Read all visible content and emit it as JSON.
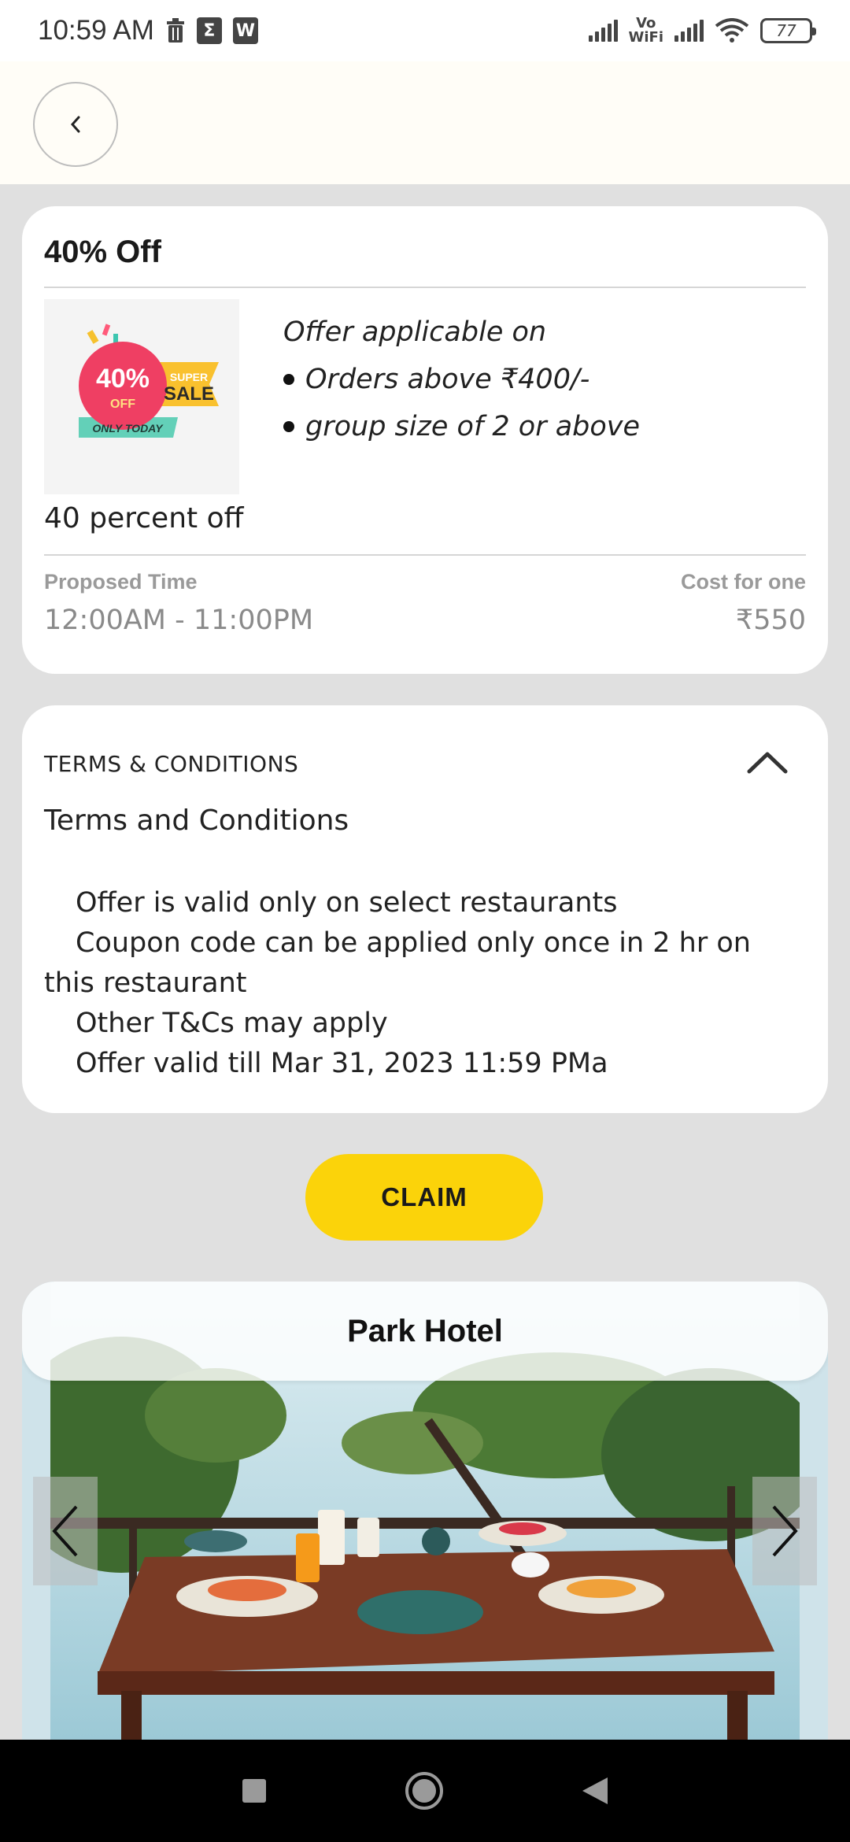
{
  "status_bar": {
    "time": "10:59 AM",
    "app_icons": [
      "trash-icon",
      "sigma-icon",
      "wps-icon"
    ],
    "vowifi_top": "Vo",
    "vowifi_bottom": "WiFi",
    "battery": "77"
  },
  "header": {
    "back_icon": "chevron-left-icon"
  },
  "offer": {
    "title": "40% Off",
    "image_badge": {
      "percent": "40%",
      "off": "OFF",
      "super": "SUPER",
      "sale": "SALE",
      "only_today": "ONLY TODAY"
    },
    "applicable_heading": "Offer applicable on",
    "conditions": [
      "Orders above ₹400/-",
      "group size of 2 or above"
    ],
    "description": "40 percent off",
    "proposed_time_label": "Proposed Time",
    "proposed_time_value": "12:00AM - 11:00PM",
    "cost_label": "Cost for one",
    "cost_value": "₹550"
  },
  "terms": {
    "heading": "TERMS & CONDITIONS",
    "title": "Terms and Conditions",
    "lines": [
      "Offer is valid only on select restaurants",
      "Coupon code can be applied only once in 2 hr on this restaurant",
      "Other T&Cs may apply",
      "Offer valid till Mar 31, 2023 11:59 PMa"
    ]
  },
  "claim_label": "CLAIM",
  "hotel": {
    "name": "Park Hotel"
  },
  "colors": {
    "accent": "#fbd30a",
    "background": "#e0e0e0",
    "header_bg": "#fffdf7"
  }
}
